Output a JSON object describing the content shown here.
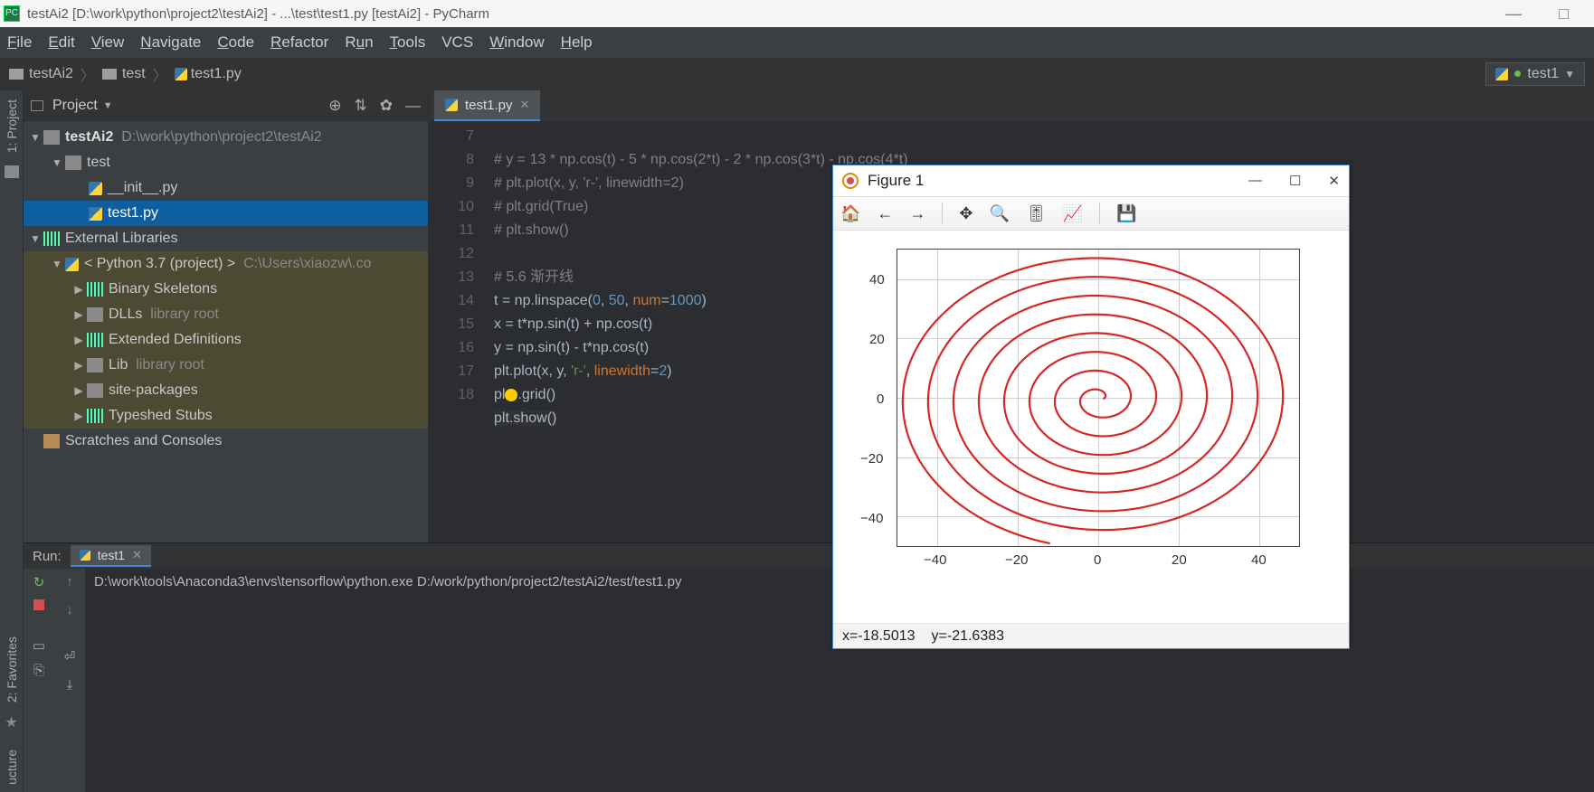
{
  "titlebar": {
    "text": "testAi2 [D:\\work\\python\\project2\\testAi2] - ...\\test\\test1.py [testAi2] - PyCharm"
  },
  "menubar": {
    "file": "File",
    "edit": "Edit",
    "view": "View",
    "navigate": "Navigate",
    "code": "Code",
    "refactor": "Refactor",
    "run": "Run",
    "tools": "Tools",
    "vcs": "VCS",
    "window": "Window",
    "help": "Help"
  },
  "breadcrumb": {
    "root": "testAi2",
    "folder": "test",
    "file": "test1.py"
  },
  "run_config": {
    "label": "test1"
  },
  "sidepanel": {
    "project_label": "1: Project",
    "favorites_label": "2: Favorites"
  },
  "project_pane": {
    "title": "Project",
    "tree": {
      "root": "testAi2",
      "root_path": "D:\\work\\python\\project2\\testAi2",
      "test": "test",
      "init": "__init__.py",
      "test1": "test1.py",
      "ext": "External Libraries",
      "py37": "< Python 3.7 (project) >",
      "py37_path": "C:\\Users\\xiaozw\\.co",
      "binskel": "Binary Skeletons",
      "dlls": "DLLs",
      "dlls_note": "library root",
      "extdef": "Extended Definitions",
      "lib": "Lib",
      "lib_note": "library root",
      "sitepkg": "site-packages",
      "typeshed": "Typeshed Stubs",
      "scratches": "Scratches and Consoles"
    }
  },
  "editor": {
    "tab": "test1.py",
    "gutter_lines": [
      "7",
      "8",
      "9",
      "10",
      "11",
      "12",
      "13",
      "14",
      "15",
      "16",
      "17",
      "18"
    ],
    "lines": {
      "l7": "# y = 13 * np.cos(t) - 5 * np.cos(2*t) - 2 * np.cos(3*t) - np.cos(4*t)",
      "l8": "# plt.plot(x, y, 'r-', linewidth=2)",
      "l9": "# plt.grid(True)",
      "l10": "# plt.show()",
      "l11": "",
      "l12": "# 5.6 渐开线",
      "l13a": "t = np.linspace(",
      "l13b": "0",
      "l13c": ", ",
      "l13d": "50",
      "l13e": ", ",
      "l13f": "num",
      "l13g": "=",
      "l13h": "1000",
      "l13i": ")",
      "l14": "x = t*np.sin(t) + np.cos(t)",
      "l15": "y = np.sin(t) - t*np.cos(t)",
      "l16a": "plt.plot(x, y, ",
      "l16b": "'r-'",
      "l16c": ", ",
      "l16d": "linewidth",
      "l16e": "=",
      "l16f": "2",
      "l16g": ")",
      "l17a": "pl",
      "l17b": ".grid()",
      "l18": "plt.show()"
    }
  },
  "run_pane": {
    "label": "Run:",
    "tab": "test1",
    "output": "D:\\work\\tools\\Anaconda3\\envs\\tensorflow\\python.exe D:/work/python/project2/testAi2/test/test1.py"
  },
  "figure": {
    "title": "Figure 1",
    "status_x": "x=-18.5013",
    "status_y": "y=-21.6383",
    "y_ticks": [
      "40",
      "20",
      "0",
      "−20",
      "−40"
    ],
    "x_ticks": [
      "−40",
      "−20",
      "0",
      "20",
      "40"
    ]
  },
  "chart_data": {
    "type": "line",
    "title": "",
    "xlabel": "",
    "ylabel": "",
    "xlim": [
      -50,
      50
    ],
    "ylim": [
      -50,
      50
    ],
    "grid": true,
    "description": "Involute spiral: x = t*sin(t)+cos(t), y = sin(t)-t*cos(t), t in [0,50], 1000 points",
    "parametric": {
      "t_start": 0,
      "t_end": 50,
      "num": 1000,
      "x_formula": "t*sin(t)+cos(t)",
      "y_formula": "sin(t)-t*cos(t)"
    },
    "series": [
      {
        "name": "r-",
        "color": "#d62728",
        "linewidth": 2
      }
    ],
    "x_ticks": [
      -40,
      -20,
      0,
      20,
      40
    ],
    "y_ticks": [
      -40,
      -20,
      0,
      20,
      40
    ]
  }
}
